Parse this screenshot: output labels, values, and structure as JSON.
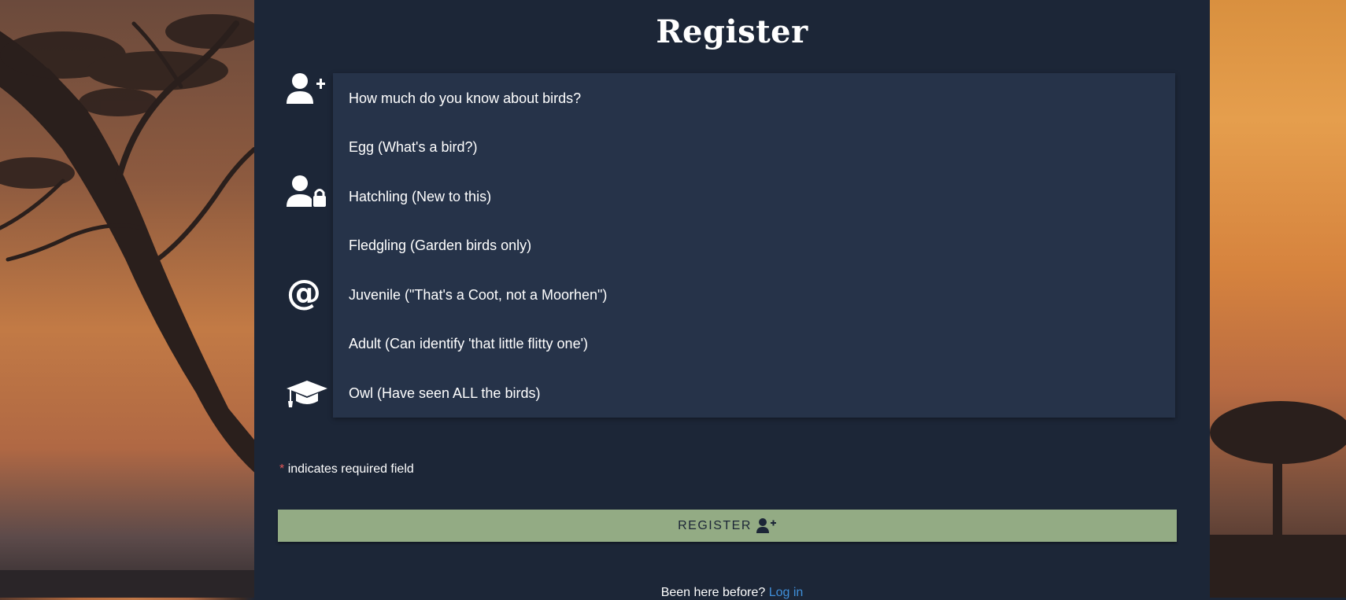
{
  "page": {
    "title": "Register"
  },
  "icons": [
    "user-plus-icon",
    "user-lock-icon",
    "at-icon",
    "graduation-cap-icon"
  ],
  "dropdown": {
    "options": [
      "How much do you know about birds?",
      "Egg (What's a bird?)",
      "Hatchling (New to this)",
      "Fledgling (Garden birds only)",
      "Juvenile (\"That's a Coot, not a Moorhen\")",
      "Adult (Can identify 'that little flitty one')",
      "Owl (Have seen ALL the birds)"
    ]
  },
  "form": {
    "required_star": "*",
    "required_note": "indicates required field",
    "register_label": "REGISTER"
  },
  "footer": {
    "prompt": "Been here before?",
    "login_link": "Log in"
  },
  "colors": {
    "panel": "#1c2637",
    "dropdown": "#263349",
    "button": "#93ab84",
    "link": "#3f8ed8",
    "required": "#e05858"
  }
}
